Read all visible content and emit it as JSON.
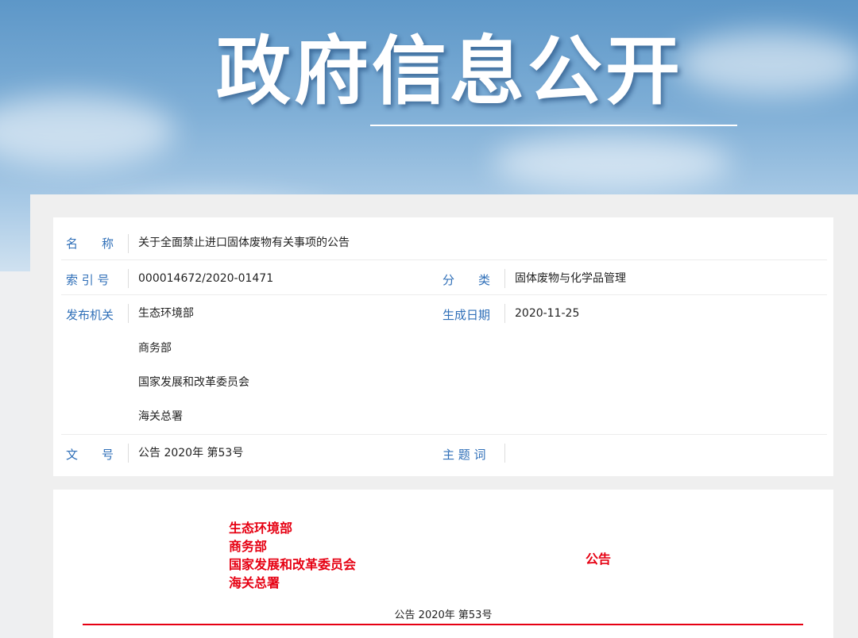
{
  "banner": {
    "title": "政府信息公开"
  },
  "info": {
    "name_label": "名　　称",
    "name_value": "关于全面禁止进口固体废物有关事项的公告",
    "index_label": "索 引 号",
    "index_value": "000014672/2020-01471",
    "category_label": "分　　类",
    "category_value": "固体废物与化学品管理",
    "issuer_label": "发布机关",
    "issuers": [
      "生态环境部",
      "商务部",
      "国家发展和改革委员会",
      "海关总署"
    ],
    "date_label": "生成日期",
    "date_value": "2020-11-25",
    "docno_label": "文　　号",
    "docno_value": "公告 2020年 第53号",
    "keywords_label": "主 题 词",
    "keywords_value": ""
  },
  "document": {
    "orgs": [
      "生态环境部",
      "商务部",
      "国家发展和改革委员会",
      "海关总署"
    ],
    "notice_title": "公告",
    "doc_number": "公告 2020年 第53号",
    "accent_color": "#e60012"
  }
}
